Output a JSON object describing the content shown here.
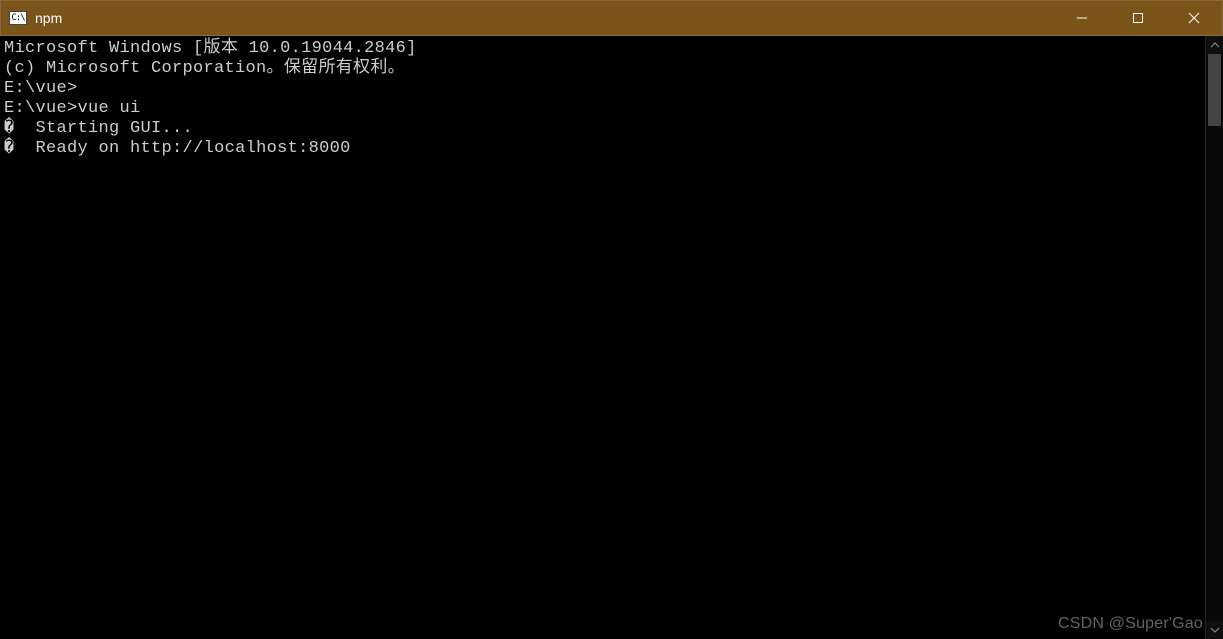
{
  "window": {
    "title": "npm",
    "icon_name": "cmd-icon"
  },
  "titlebar_buttons": {
    "minimize": "─",
    "maximize": "☐",
    "close": "✕"
  },
  "terminal": {
    "lines": [
      {
        "prefix": "",
        "text": "Microsoft Windows [版本 10.0.19044.2846]"
      },
      {
        "prefix": "",
        "text": "(c) Microsoft Corporation。保留所有权利。"
      },
      {
        "prefix": "",
        "text": ""
      },
      {
        "prefix": "",
        "text": "E:\\vue>"
      },
      {
        "prefix": "",
        "text": "E:\\vue>vue ui"
      },
      {
        "prefix": "�  ",
        "text": "Starting GUI..."
      },
      {
        "prefix": "�  ",
        "text": "Ready on http://localhost:8000"
      }
    ]
  },
  "watermark": "CSDN @Super'Gao"
}
